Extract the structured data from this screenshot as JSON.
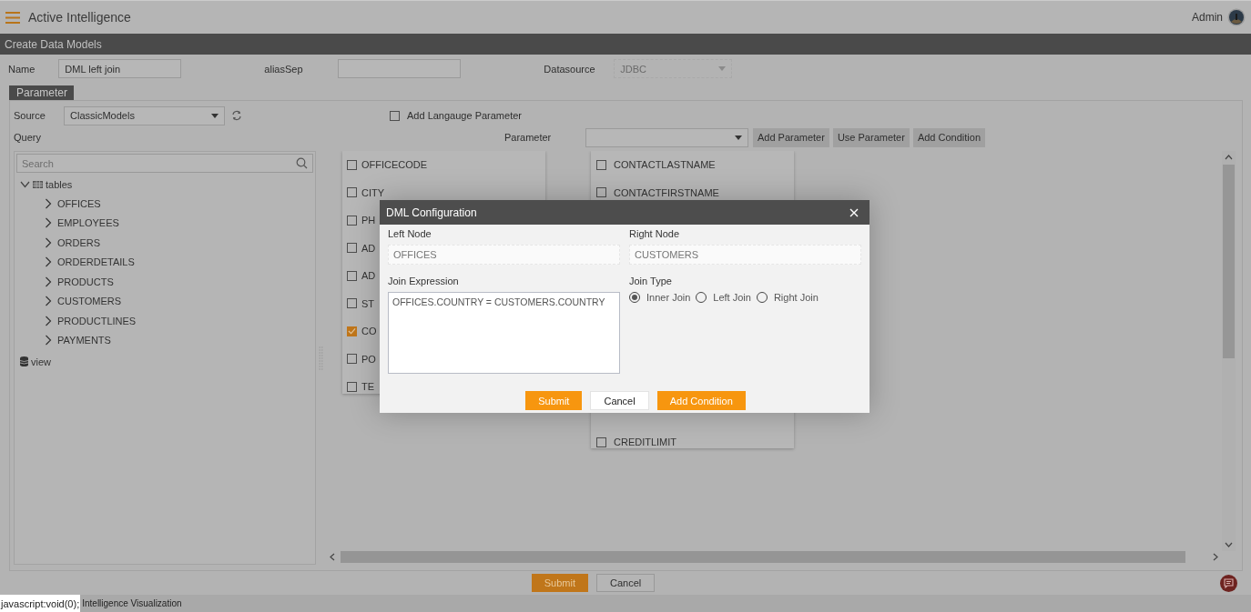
{
  "app": {
    "title": "Active Intelligence",
    "user": "Admin"
  },
  "page_title": "Create Data Models",
  "form": {
    "name_label": "Name",
    "name_value": "DML left join",
    "alias_label": "aliasSep",
    "datasource_label": "Datasource",
    "datasource_value": "JDBC",
    "datasource_disabled": true
  },
  "tabs": [
    {
      "label": "Parameter",
      "selected": true
    }
  ],
  "source": {
    "label": "Source",
    "value": "ClassicModels"
  },
  "language_param": {
    "label": "Add Langauge Parameter",
    "checked": false
  },
  "query_label": "Query",
  "parameter_label": "Parameter",
  "toolbar_buttons": [
    "Add Parameter",
    "Use Parameter",
    "Add Condition"
  ],
  "tree": {
    "search_placeholder": "Search",
    "nodes": [
      {
        "label": "tables",
        "kind": "table",
        "expanded": true,
        "children": [
          {
            "label": "OFFICES",
            "expanded": false
          },
          {
            "label": "EMPLOYEES",
            "expanded": false
          },
          {
            "label": "ORDERS",
            "expanded": false
          },
          {
            "label": "ORDERDETAILS",
            "expanded": false
          },
          {
            "label": "PRODUCTS",
            "expanded": false
          },
          {
            "label": "CUSTOMERS",
            "expanded": false
          },
          {
            "label": "PRODUCTLINES",
            "expanded": false
          },
          {
            "label": "PAYMENTS",
            "expanded": false
          }
        ]
      },
      {
        "label": "view",
        "kind": "database"
      }
    ]
  },
  "canvas_tables": [
    {
      "columns": [
        {
          "name": "OFFICECODE",
          "checked": false
        },
        {
          "name": "CITY",
          "checked": false
        },
        {
          "name": "PH",
          "checked": false
        },
        {
          "name": "AD",
          "checked": false
        },
        {
          "name": "AD",
          "checked": false
        },
        {
          "name": "ST",
          "checked": false
        },
        {
          "name": "CO",
          "checked": true
        },
        {
          "name": "PO",
          "checked": false
        },
        {
          "name": "TE",
          "checked": false
        }
      ]
    },
    {
      "columns": [
        {
          "name": "CONTACTLASTNAME",
          "checked": false
        },
        {
          "name": "CONTACTFIRSTNAME",
          "checked": false
        }
      ],
      "lower_columns": [
        {
          "name": "CREDITLIMIT",
          "checked": false
        }
      ]
    }
  ],
  "dialog": {
    "title": "DML Configuration",
    "left_node_label": "Left Node",
    "left_node": "OFFICES",
    "right_node_label": "Right Node",
    "right_node": "CUSTOMERS",
    "expression_label": "Join Expression",
    "expression": "OFFICES.COUNTRY = CUSTOMERS.COUNTRY",
    "join_type_label": "Join Type",
    "join_types": [
      {
        "label": "Inner Join",
        "selected": true
      },
      {
        "label": "Left Join",
        "selected": false
      },
      {
        "label": "Right Join",
        "selected": false
      }
    ],
    "buttons": [
      {
        "label": "Submit",
        "kind": "primary"
      },
      {
        "label": "Cancel",
        "kind": "secondary"
      },
      {
        "label": "Add Condition",
        "kind": "primary"
      }
    ]
  },
  "footer_buttons": [
    {
      "label": "Submit",
      "kind": "primary"
    },
    {
      "label": "Cancel",
      "kind": "secondary"
    }
  ],
  "status_bar": {
    "link_preview": "javascript:void(0);",
    "text": "Intelligence Visualization"
  }
}
